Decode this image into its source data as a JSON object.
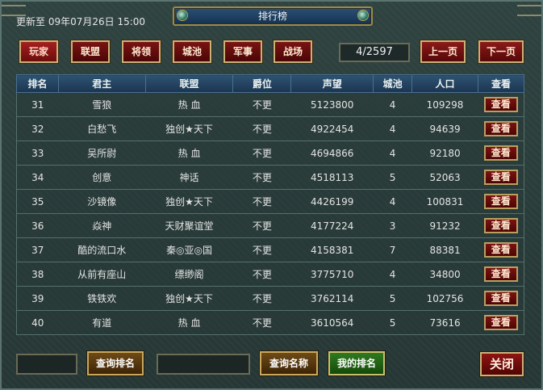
{
  "header": {
    "update_text": "更新至 09年07月26日 15:00",
    "title": "排行榜"
  },
  "tabs": [
    {
      "label": "玩家",
      "active": true
    },
    {
      "label": "联盟",
      "active": false
    },
    {
      "label": "将领",
      "active": false
    },
    {
      "label": "城池",
      "active": false
    },
    {
      "label": "军事",
      "active": false
    },
    {
      "label": "战场",
      "active": false
    }
  ],
  "pager": {
    "indicator": "4/2597",
    "prev_label": "上一页",
    "next_label": "下一页"
  },
  "table": {
    "columns": [
      "排名",
      "君主",
      "联盟",
      "爵位",
      "声望",
      "城池",
      "人口",
      "查看"
    ],
    "view_label": "查看",
    "rows": [
      [
        "31",
        "雪狼",
        "热 血",
        "不更",
        "5123800",
        "4",
        "109298"
      ],
      [
        "32",
        "白愁飞",
        "独创★天下",
        "不更",
        "4922454",
        "4",
        "94639"
      ],
      [
        "33",
        "吴所尉",
        "热 血",
        "不更",
        "4694866",
        "4",
        "92180"
      ],
      [
        "34",
        "创意",
        "神话",
        "不更",
        "4518113",
        "5",
        "52063"
      ],
      [
        "35",
        "沙镜像",
        "独创★天下",
        "不更",
        "4426199",
        "4",
        "100831"
      ],
      [
        "36",
        "焱神",
        "天财聚谊堂",
        "不更",
        "4177224",
        "3",
        "91232"
      ],
      [
        "37",
        "酷的流口水",
        "秦◎亚◎国",
        "不更",
        "4158381",
        "7",
        "88381"
      ],
      [
        "38",
        "从前有座山",
        "缥缈阁",
        "不更",
        "3775710",
        "4",
        "34800"
      ],
      [
        "39",
        "铁铁欢",
        "独创★天下",
        "不更",
        "3762114",
        "5",
        "102756"
      ],
      [
        "40",
        "有道",
        "热 血",
        "不更",
        "3610564",
        "5",
        "73616"
      ]
    ]
  },
  "bottom": {
    "query_rank_label": "查询排名",
    "query_name_label": "查询名称",
    "my_rank_label": "我的排名",
    "close_label": "关闭",
    "rank_input_value": "",
    "name_input_value": ""
  }
}
